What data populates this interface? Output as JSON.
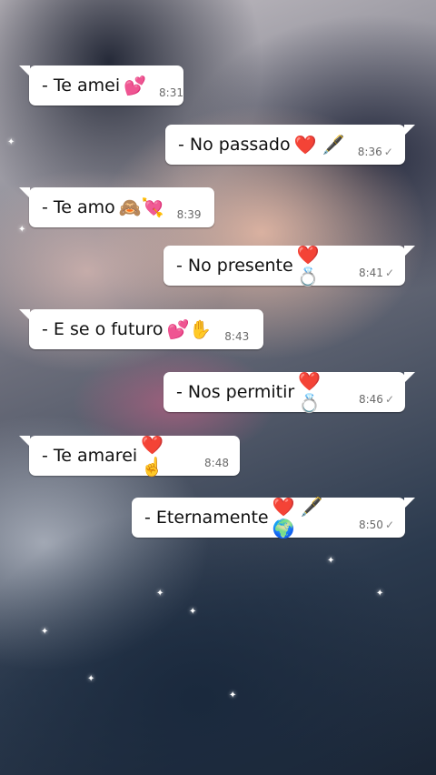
{
  "chat": {
    "messages": [
      {
        "text": "- Te amei",
        "emoji": "💕",
        "time": "8:31",
        "direction": "in"
      },
      {
        "text": "- No passado",
        "emoji": "❤️ 🖋️",
        "time": "8:36",
        "direction": "out"
      },
      {
        "text": "- Te amo",
        "emoji": "🙈💘",
        "time": "8:39",
        "direction": "in"
      },
      {
        "text": "- No presente",
        "emoji": "❤️ 💍",
        "time": "8:41",
        "direction": "out"
      },
      {
        "text": "- E se o futuro",
        "emoji": "💕✋",
        "time": "8:43",
        "direction": "in"
      },
      {
        "text": "- Nos permitir",
        "emoji": "❤️ 💍",
        "time": "8:46",
        "direction": "out"
      },
      {
        "text": "- Te amarei",
        "emoji": "❤️ ☝️",
        "time": "8:48",
        "direction": "in"
      },
      {
        "text": "- Eternamente",
        "emoji": "❤️ 🖋️ 🌍",
        "time": "8:50",
        "direction": "out"
      }
    ],
    "check_glyph": "✓"
  },
  "colors": {
    "bubble": "#ffffff",
    "heart": "#e0202b",
    "time": "#6a6a6a"
  }
}
